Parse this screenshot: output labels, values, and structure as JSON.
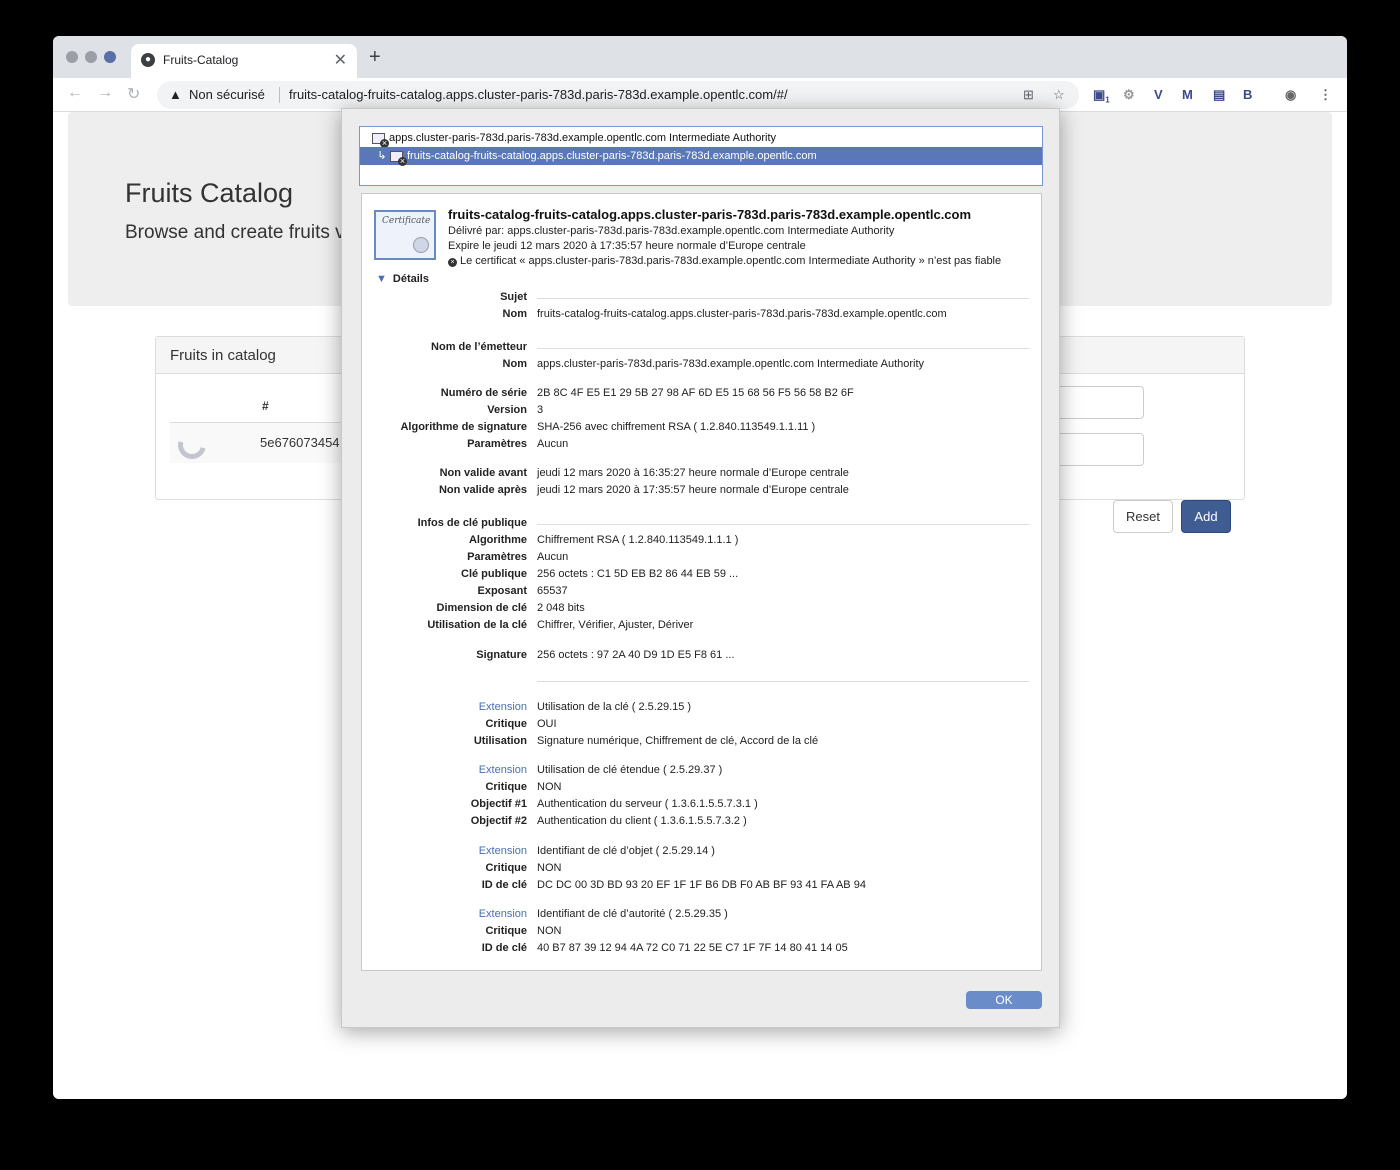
{
  "browser": {
    "tab_title": "Fruits-Catalog",
    "tab_close": "✕",
    "new_tab": "+",
    "insecure_label": "Non sécurisé",
    "url": "fruits-catalog-fruits-catalog.apps.cluster-paris-783d.paris-783d.example.opentlc.com/#/",
    "ext_badge": "1"
  },
  "page": {
    "title": "Fruits Catalog",
    "subtitle": "Browse and create fruits v",
    "panel_heading": "Fruits in catalog",
    "table_header": "#",
    "row_id": "5e676073454",
    "reset_label": "Reset",
    "add_label": "Add"
  },
  "dialog": {
    "chain": [
      "apps.cluster-paris-783d.paris-783d.example.opentlc.com Intermediate Authority",
      "fruits-catalog-fruits-catalog.apps.cluster-paris-783d.paris-783d.example.opentlc.com"
    ],
    "cert_title": "fruits-catalog-fruits-catalog.apps.cluster-paris-783d.paris-783d.example.opentlc.com",
    "issued_by": "Délivré par: apps.cluster-paris-783d.paris-783d.example.opentlc.com Intermediate Authority",
    "expires": "Expire le jeudi 12 mars 2020 à 17:35:57 heure normale d’Europe centrale",
    "untrusted": "Le certificat « apps.cluster-paris-783d.paris-783d.example.opentlc.com Intermediate Authority » n’est pas fiable",
    "details_label": "Détails",
    "fields": [
      {
        "label": "Sujet",
        "value": ""
      },
      {
        "label": "Nom",
        "value": "fruits-catalog-fruits-catalog.apps.cluster-paris-783d.paris-783d.example.opentlc.com"
      },
      {
        "label": "Nom de l’émetteur",
        "value": ""
      },
      {
        "label": "Nom",
        "value": "apps.cluster-paris-783d.paris-783d.example.opentlc.com Intermediate Authority"
      },
      {
        "label": "Numéro de série",
        "value": "2B 8C 4F E5 E1 29 5B 27 98 AF 6D E5 15 68 56 F5 56 58 B2 6F"
      },
      {
        "label": "Version",
        "value": "3"
      },
      {
        "label": "Algorithme de signature",
        "value": "SHA-256 avec chiffrement RSA ( 1.2.840.113549.1.1.11 )"
      },
      {
        "label": "Paramètres",
        "value": "Aucun"
      },
      {
        "label": "Non valide avant",
        "value": "jeudi 12 mars 2020 à 16:35:27 heure normale d’Europe centrale"
      },
      {
        "label": "Non valide après",
        "value": "jeudi 12 mars 2020 à 17:35:57 heure normale d’Europe centrale"
      },
      {
        "label": "Infos de clé publique",
        "value": ""
      },
      {
        "label": "Algorithme",
        "value": "Chiffrement RSA ( 1.2.840.113549.1.1.1 )"
      },
      {
        "label": "Paramètres",
        "value": "Aucun"
      },
      {
        "label": "Clé publique",
        "value": "256 octets : C1 5D EB B2 86 44 EB 59 ..."
      },
      {
        "label": "Exposant",
        "value": "65537"
      },
      {
        "label": "Dimension de clé",
        "value": "2 048 bits"
      },
      {
        "label": "Utilisation de la clé",
        "value": "Chiffrer, Vérifier, Ajuster, Dériver"
      },
      {
        "label": "Signature",
        "value": "256 octets : 97 2A 40 D9 1D E5 F8 61 ..."
      },
      {
        "label": "Extension",
        "value": "Utilisation de la clé ( 2.5.29.15 )"
      },
      {
        "label": "Critique",
        "value": "OUI"
      },
      {
        "label": "Utilisation",
        "value": "Signature numérique, Chiffrement de clé, Accord de la clé"
      },
      {
        "label": "Extension",
        "value": "Utilisation de clé étendue ( 2.5.29.37 )"
      },
      {
        "label": "Critique",
        "value": "NON"
      },
      {
        "label": "Objectif #1",
        "value": "Authentication du serveur ( 1.3.6.1.5.5.7.3.1 )"
      },
      {
        "label": "Objectif #2",
        "value": "Authentication du client ( 1.3.6.1.5.5.7.3.2 )"
      },
      {
        "label": "Extension",
        "value": "Identifiant de clé d’objet ( 2.5.29.14 )"
      },
      {
        "label": "Critique",
        "value": "NON"
      },
      {
        "label": "ID de clé",
        "value": "DC DC 00 3D BD 93 20 EF 1F 1F B6 DB F0 AB BF 93 41 FA AB 94"
      },
      {
        "label": "Extension",
        "value": "Identifiant de clé d’autorité ( 2.5.29.35 )"
      },
      {
        "label": "Critique",
        "value": "NON"
      },
      {
        "label": "ID de clé",
        "value": "40 B7 87 39 12 94 4A 72 C0 71 22 5E C7 1F 7F 14 80 41 14 05"
      }
    ],
    "ok_label": "OK"
  }
}
